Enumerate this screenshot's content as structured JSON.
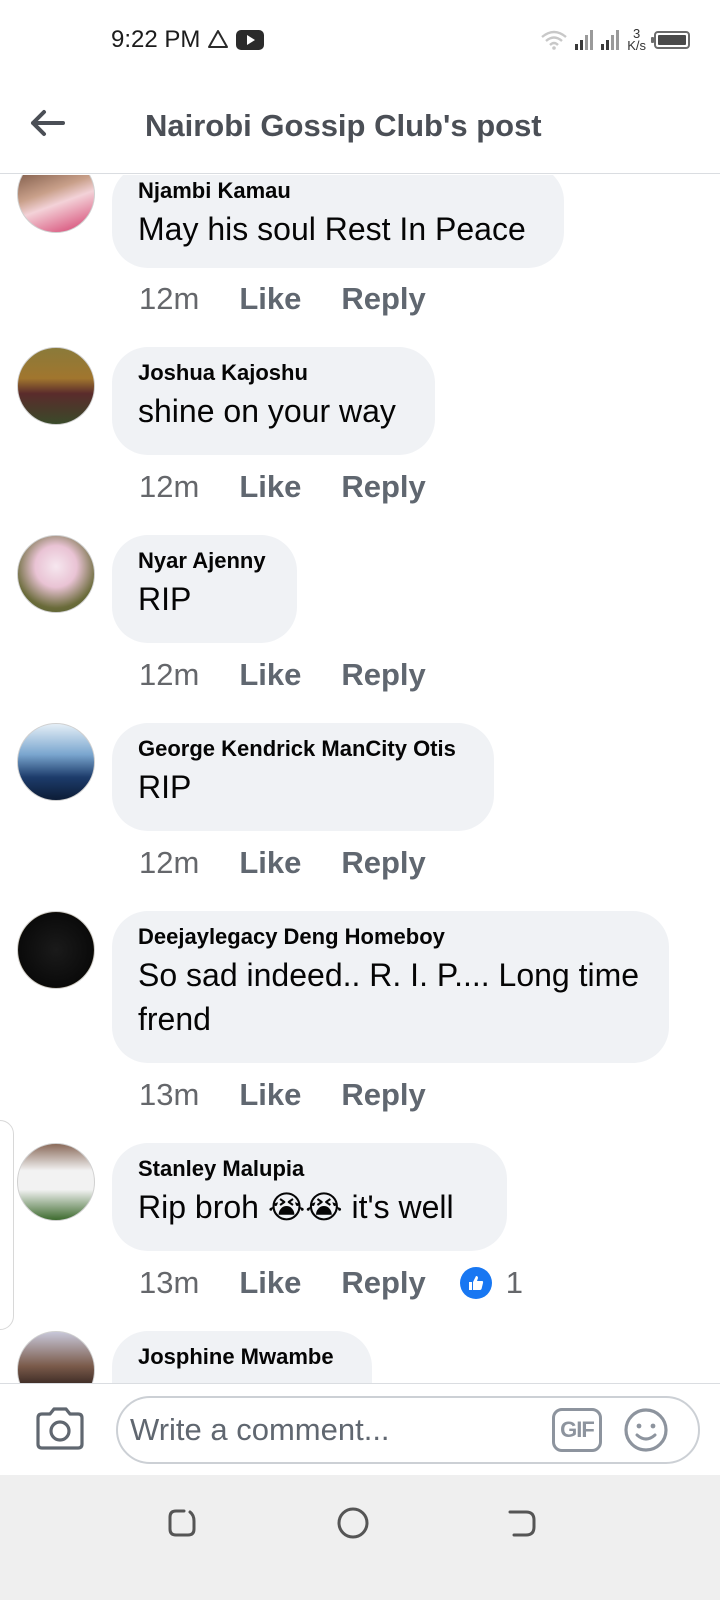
{
  "status_bar": {
    "time": "9:22 PM",
    "net_speed_value": "3",
    "net_speed_unit": "K/s",
    "icons": [
      "alert-triangle-icon",
      "youtube-icon",
      "wifi-icon",
      "signal-icon",
      "signal-icon",
      "battery-icon"
    ]
  },
  "header": {
    "title": "Nairobi Gossip Club's post",
    "back_icon": "arrow-left-icon"
  },
  "comments": [
    {
      "name": "Njambi Kamau",
      "text": "May his soul Rest In Peace",
      "time": "12m",
      "like": "Like",
      "reply": "Reply"
    },
    {
      "name": "Joshua Kajoshu",
      "text": "shine on your way",
      "time": "12m",
      "like": "Like",
      "reply": "Reply"
    },
    {
      "name": "Nyar Ajenny",
      "text": "RIP",
      "time": "12m",
      "like": "Like",
      "reply": "Reply"
    },
    {
      "name": "George Kendrick ManCity Otis",
      "text": "RIP",
      "time": "12m",
      "like": "Like",
      "reply": "Reply"
    },
    {
      "name": "Deejaylegacy Deng Homeboy",
      "text_line1": "So sad indeed.. R. I. P.... Long time",
      "text_line2": "frend",
      "time": "13m",
      "like": "Like",
      "reply": "Reply"
    },
    {
      "name": "Stanley Malupia",
      "text": "Rip broh 😭😭 it's well",
      "time": "13m",
      "like": "Like",
      "reply": "Reply",
      "reaction_count": "1"
    },
    {
      "name": "Josphine Mwambe"
    }
  ],
  "composer": {
    "placeholder": "Write a comment...",
    "gif_label": "GIF",
    "icons": [
      "camera-icon",
      "gif-icon",
      "emoji-icon"
    ]
  },
  "nav_bar": {
    "icons": [
      "recents-icon",
      "home-icon",
      "back-icon"
    ]
  },
  "colors": {
    "bubble": "#f0f2f5",
    "secondary_text": "#65676b",
    "like_blue": "#1877f2",
    "nav_background": "#efefef"
  }
}
